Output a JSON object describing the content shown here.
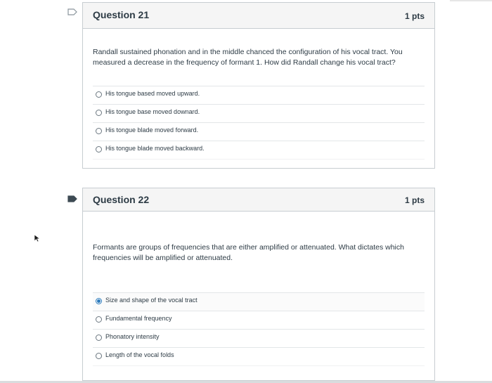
{
  "questions": [
    {
      "title": "Question 21",
      "points": "1 pts",
      "text": "Randall sustained phonation and in the middle chanced the configuration of his vocal tract. You measured a decrease in the frequency of formant 1. How did Randall change his vocal tract?",
      "answers": [
        {
          "label": "His tongue based moved upward.",
          "selected": false
        },
        {
          "label": "His tongue base moved downard.",
          "selected": false
        },
        {
          "label": "His tongue blade moved forward.",
          "selected": false
        },
        {
          "label": "His tongue blade moved backward.",
          "selected": false
        }
      ],
      "flag_icon": "flag-outline-icon"
    },
    {
      "title": "Question 22",
      "points": "1 pts",
      "text": "Formants are groups of frequencies that are either amplified or attenuated. What dictates which frequencies will be amplified or attenuated.",
      "answers": [
        {
          "label": "Size and shape of the vocal tract",
          "selected": true
        },
        {
          "label": "Fundamental frequency",
          "selected": false
        },
        {
          "label": "Phonatory intensity",
          "selected": false
        },
        {
          "label": "Length of the vocal folds",
          "selected": false
        }
      ],
      "flag_icon": "flag-filled-icon"
    }
  ],
  "colors": {
    "accent": "#2b7abc",
    "border": "#c7cdd1",
    "header_bg": "#f5f5f5",
    "text": "#2d3b45",
    "flag_filled": "#3d4a53"
  }
}
